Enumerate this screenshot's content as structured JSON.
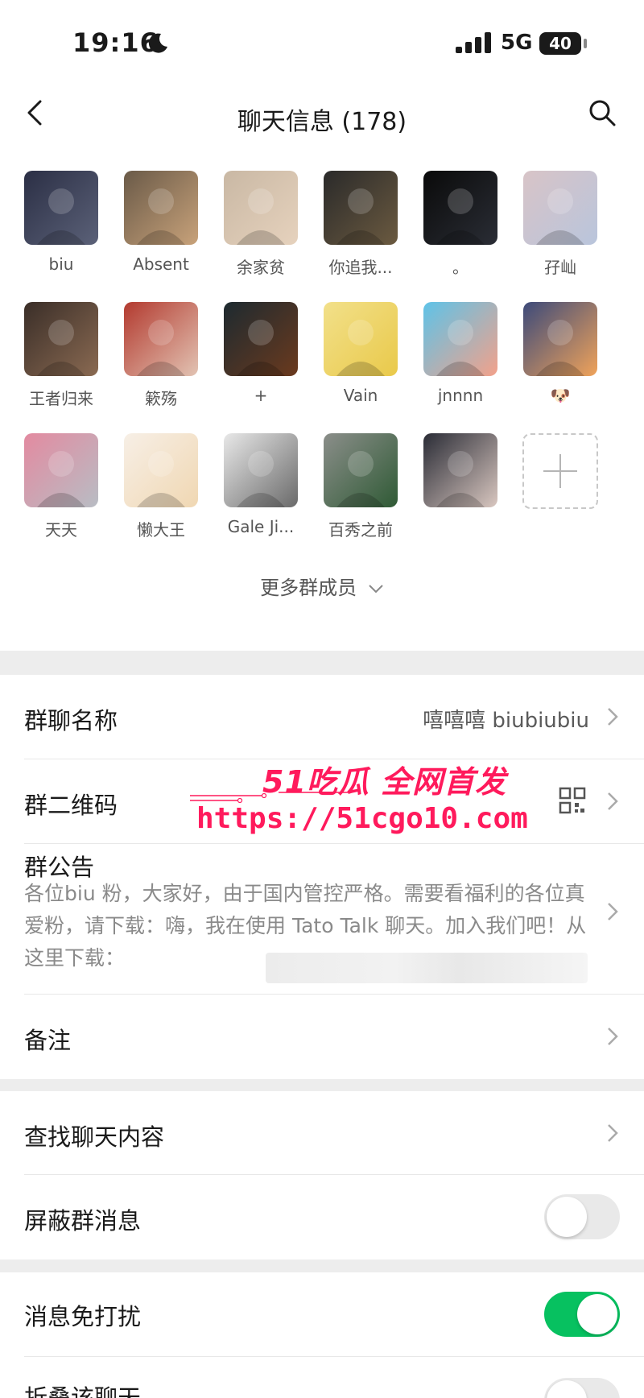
{
  "status_bar": {
    "time": "19:16",
    "network": "5G",
    "battery": "40"
  },
  "nav": {
    "title": "聊天信息 (178)"
  },
  "members": [
    {
      "name": "biu",
      "colors": [
        "#2b2f45",
        "#5b6178"
      ]
    },
    {
      "name": "Absent",
      "colors": [
        "#6a5a48",
        "#c8a27a"
      ]
    },
    {
      "name": "余家贫",
      "colors": [
        "#c9b8a4",
        "#e6d2bd"
      ]
    },
    {
      "name": "你追我...",
      "colors": [
        "#2a2a2a",
        "#6b5a40"
      ]
    },
    {
      "name": "。",
      "colors": [
        "#0a0a0a",
        "#2a2d35"
      ]
    },
    {
      "name": "孖屾",
      "colors": [
        "#d8c4c7",
        "#b9c5dc"
      ]
    },
    {
      "name": "王者归来",
      "colors": [
        "#3a2e28",
        "#8a6a52"
      ]
    },
    {
      "name": "簌殇",
      "colors": [
        "#b33a2f",
        "#e2c3b3"
      ]
    },
    {
      "name": "+",
      "colors": [
        "#1d2a30",
        "#6b3a1e"
      ]
    },
    {
      "name": "Vain",
      "colors": [
        "#f2e08a",
        "#e9c94a"
      ]
    },
    {
      "name": "jnnnn",
      "colors": [
        "#5ec3e8",
        "#f3a18a"
      ]
    },
    {
      "name": "🐶",
      "colors": [
        "#3c4a7a",
        "#f0a35a"
      ]
    },
    {
      "name": "天天",
      "colors": [
        "#e38aa0",
        "#b8bdc4"
      ]
    },
    {
      "name": "懒大王",
      "colors": [
        "#f7efe6",
        "#f0d7b2"
      ]
    },
    {
      "name": "Gale Ji...",
      "colors": [
        "#e8e8e8",
        "#6a6a6a"
      ]
    },
    {
      "name": "百秀之前",
      "colors": [
        "#8b8e8a",
        "#2f5a35"
      ]
    },
    {
      "name": "",
      "colors": [
        "#2a2c36",
        "#d9c7c0"
      ]
    }
  ],
  "more_members": "更多群成员",
  "rows": {
    "group_name": {
      "label": "群聊名称",
      "value": "嘻嘻嘻 biubiubiu"
    },
    "qr_code": {
      "label": "群二维码"
    },
    "notice": {
      "label": "群公告",
      "text": "各位biu 粉，大家好，由于国内管控严格。需要看福利的各位真爱粉，请下载：嗨，我在使用 Tato Talk 聊天。加入我们吧！从这里下载："
    },
    "remark": {
      "label": "备注"
    },
    "search_history": {
      "label": "查找聊天内容"
    },
    "block_messages": {
      "label": "屏蔽群消息",
      "on": false
    },
    "mute": {
      "label": "消息免打扰",
      "on": true
    },
    "fold": {
      "label": "折叠该聊天"
    }
  },
  "watermark": {
    "brand": "51吃瓜 全网首发",
    "url": "https://51cgo10.com"
  },
  "colors": {
    "accent_green": "#07c160",
    "watermark": "#ff1a5c",
    "gap": "#ededed"
  }
}
